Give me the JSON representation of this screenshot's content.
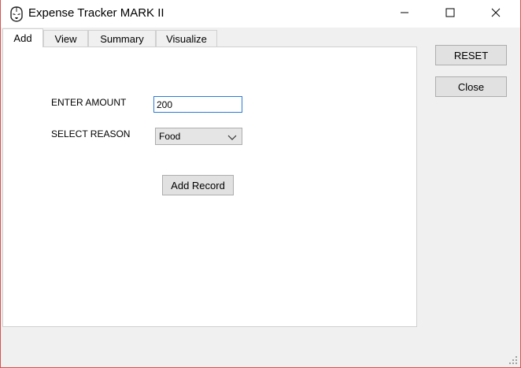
{
  "window": {
    "title": "Expense Tracker MARK II",
    "icon": "iron-helmet-icon",
    "controls": [
      "minimize-icon",
      "maximize-icon",
      "close-icon"
    ]
  },
  "tabs": [
    {
      "label": "Add",
      "active": true
    },
    {
      "label": "View",
      "active": false
    },
    {
      "label": "Summary",
      "active": false
    },
    {
      "label": "Visualize",
      "active": false
    }
  ],
  "form": {
    "amount_label": "ENTER AMOUNT",
    "amount_value": "200",
    "reason_label": "SELECT REASON",
    "reason_value": "Food",
    "add_button": "Add Record"
  },
  "side_buttons": {
    "reset": "RESET",
    "close": "Close"
  },
  "colors": {
    "input_focus": "#2b7bd6",
    "window_border": "#d9534f"
  }
}
